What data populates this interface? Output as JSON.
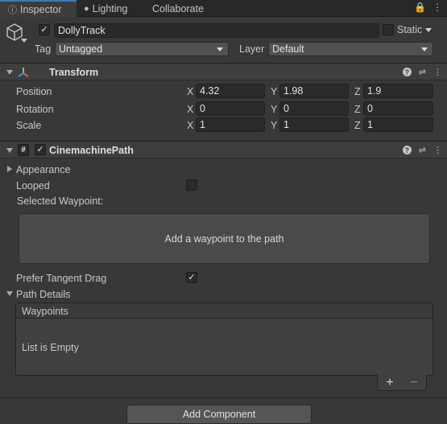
{
  "tabs": [
    {
      "label": "Inspector",
      "icon": "info-icon",
      "active": true
    },
    {
      "label": "Lighting",
      "icon": "bulb-icon",
      "active": false
    },
    {
      "label": "Collaborate",
      "icon": "",
      "active": false
    }
  ],
  "object": {
    "name": "DollyTrack",
    "active": true,
    "static_label": "Static",
    "tag_label": "Tag",
    "tag_value": "Untagged",
    "layer_label": "Layer",
    "layer_value": "Default"
  },
  "transform": {
    "title": "Transform",
    "rows": [
      {
        "label": "Position",
        "x": "4.32",
        "y": "1.98",
        "z": "1.9"
      },
      {
        "label": "Rotation",
        "x": "0",
        "y": "0",
        "z": "0"
      },
      {
        "label": "Scale",
        "x": "1",
        "y": "1",
        "z": "1"
      }
    ],
    "axes": [
      "X",
      "Y",
      "Z"
    ]
  },
  "path": {
    "title": "CinemachinePath",
    "appearance_label": "Appearance",
    "looped_label": "Looped",
    "looped": false,
    "selected_waypoint_label": "Selected Waypoint:",
    "add_waypoint_text": "Add a waypoint to the path",
    "prefer_tangent_label": "Prefer Tangent Drag",
    "prefer_tangent": true,
    "path_details_label": "Path Details",
    "waypoints_header": "Waypoints",
    "list_empty_text": "List is Empty",
    "add_symbol": "+",
    "remove_symbol": "−"
  },
  "add_component_label": "Add Component",
  "colors": {
    "background": "#383838",
    "tab_accent": "#3a79bb",
    "field_bg": "#2a2a2a"
  }
}
